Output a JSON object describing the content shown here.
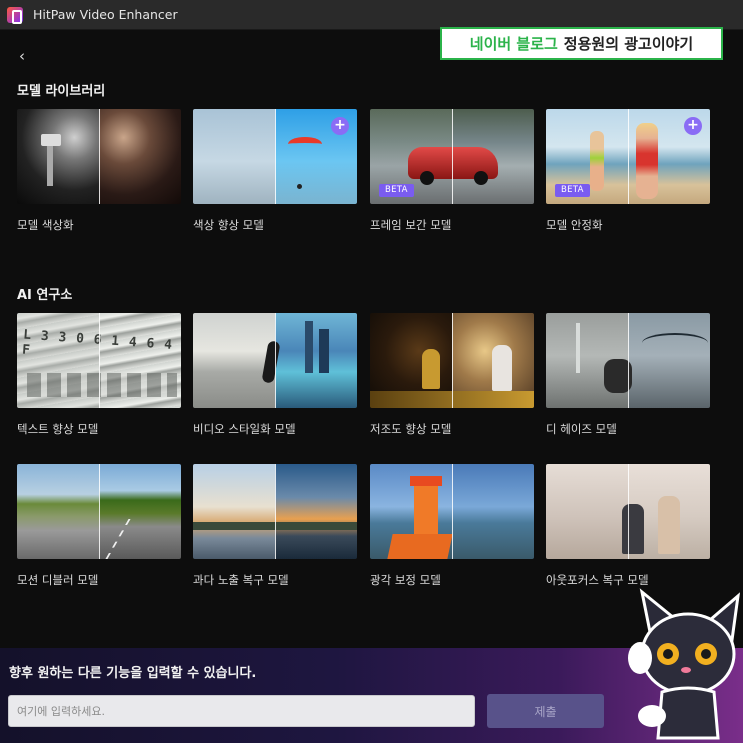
{
  "app": {
    "title": "HitPaw Video Enhancer"
  },
  "overlay": {
    "blog_green": "네이버 블로그",
    "blog_dark": "정용원의 광고이야기"
  },
  "nav": {
    "back_glyph": "‹"
  },
  "sections": {
    "library": {
      "title": "모델 라이브러리",
      "cards": [
        {
          "label": "모델 색상화",
          "badge": "",
          "plus": false
        },
        {
          "label": "색상 향상 모델",
          "badge": "",
          "plus": true
        },
        {
          "label": "프레임 보간 모델",
          "badge": "BETA",
          "plus": false
        },
        {
          "label": "모델 안정화",
          "badge": "BETA",
          "plus": true
        }
      ]
    },
    "lab": {
      "title": "AI 연구소",
      "cards": [
        {
          "label": "텍스트 향상 모델"
        },
        {
          "label": "비디오 스타일화 모델"
        },
        {
          "label": "저조도 향상 모델"
        },
        {
          "label": "디 헤이즈 모델"
        },
        {
          "label": "모션 디블러 모델"
        },
        {
          "label": "과다 노출 복구 모델"
        },
        {
          "label": "광각 보정 모델"
        },
        {
          "label": "아웃포커스 복구 모델"
        }
      ]
    }
  },
  "footer": {
    "prompt": "향후 원하는 다른 기능을 입력할 수 있습니다.",
    "input_placeholder": "여기에 입력하세요.",
    "input_value": "",
    "submit_label": "제출"
  },
  "colors": {
    "accent": "#7a5cf0",
    "badge": "#7a5cf0",
    "overlay_green": "#2bb34a"
  },
  "icons": [
    "app-logo-icon",
    "chevron-left-icon",
    "plus-icon",
    "cat-mascot-icon"
  ]
}
